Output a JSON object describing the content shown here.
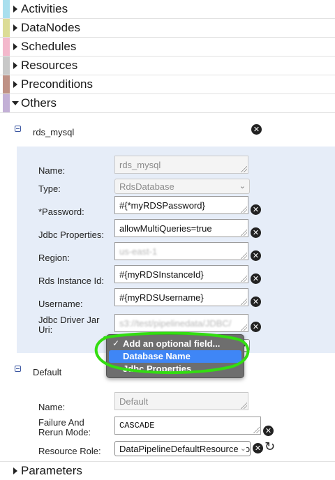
{
  "sections": [
    {
      "label": "Activities",
      "color": "#a9dfee",
      "expanded": false
    },
    {
      "label": "DataNodes",
      "color": "#dcdc96",
      "expanded": false
    },
    {
      "label": "Schedules",
      "color": "#f3b8cc",
      "expanded": false
    },
    {
      "label": "Resources",
      "color": "#c8c8c8",
      "expanded": false
    },
    {
      "label": "Preconditions",
      "color": "#bf9185",
      "expanded": false
    },
    {
      "label": "Others",
      "color": "#c3b0d6",
      "expanded": true
    }
  ],
  "footer_section": {
    "label": "Parameters",
    "expanded": false
  },
  "rds_object": {
    "title": "rds_mysql",
    "fields": {
      "name": {
        "label": "Name:",
        "value": "rds_mysql"
      },
      "type": {
        "label": "Type:",
        "value": "RdsDatabase"
      },
      "password": {
        "label": "*Password:",
        "value": "#{*myRDSPassword}"
      },
      "jdbc_properties": {
        "label": "Jdbc Properties:",
        "value": "allowMultiQueries=true"
      },
      "region": {
        "label": "Region:",
        "value": "us-east-1"
      },
      "rds_instance_id": {
        "label": "Rds Instance Id:",
        "value": "#{myRDSInstanceId}"
      },
      "username": {
        "label": "Username:",
        "value": "#{myRDSUsername}"
      },
      "jdbc_driver_jar_uri": {
        "label_line1": "Jdbc Driver Jar",
        "label_line2": "Uri:",
        "value": "s3://test/pipelinedata/JDBC/"
      }
    },
    "add_optional_dropdown": {
      "options": [
        "Add an optional field...",
        "Database Name",
        "Jdbc Properties"
      ],
      "checked_index": 0,
      "highlighted_index": 1,
      "highlight_color": "#3f86f6",
      "annotation_color": "#33dd11"
    }
  },
  "default_object": {
    "title": "Default",
    "fields": {
      "name": {
        "label": "Name:",
        "value": "Default"
      },
      "failure_and_rerun_mode": {
        "label_line1": "Failure And",
        "label_line2": "Rerun Mode:",
        "value": "CASCADE"
      },
      "resource_role": {
        "label": "Resource Role:",
        "value": "DataPipelineDefaultResourceRole"
      }
    }
  },
  "icons": {
    "remove": "remove-field-icon",
    "collapse": "collapse-icon",
    "refresh": "refresh-icon"
  }
}
